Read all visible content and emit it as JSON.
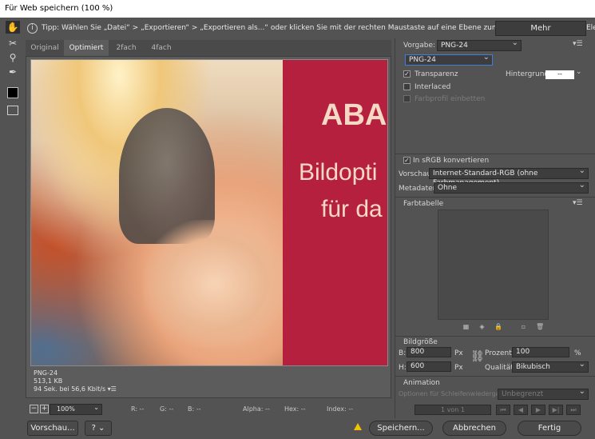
{
  "window": {
    "title": "Für Web speichern (100 %)"
  },
  "hint": {
    "icon": "info-icon",
    "text": "Tipp: Wählen Sie „Datei“ > „Exportieren“ > „Exportieren als...“ oder klicken Sie mit der rechten Maustaste auf eine Ebene zum schnelleren Export von Elementen",
    "more_label": "Mehr"
  },
  "tools": [
    "hand-icon",
    "slice-select-icon",
    "zoom-icon",
    "eyedropper-icon",
    "color-swatch",
    "toggle-slices-icon"
  ],
  "tabs": [
    {
      "label": "Original",
      "active": false
    },
    {
      "label": "Optimiert",
      "active": true
    },
    {
      "label": "2fach",
      "active": false
    },
    {
      "label": "4fach",
      "active": false
    }
  ],
  "preview": {
    "headline": "ABA",
    "line2": "Bildopti",
    "line3": "für da",
    "panel_color": "#b5203f"
  },
  "image_info": {
    "format": "PNG-24",
    "size": "513,1 KB",
    "time": "94 Sek. bei 56,6 Kbit/s"
  },
  "statusbar": {
    "zoom_minus": "−",
    "zoom_plus": "+",
    "zoom": "100%",
    "r": "R: --",
    "g": "G: --",
    "b": "B: --",
    "alpha": "Alpha: --",
    "hex": "Hex: --",
    "index": "Index: --"
  },
  "footer": {
    "preview_label": "Vorschau...",
    "help_icon": "help-icon",
    "save_label": "Speichern...",
    "cancel_label": "Abbrechen",
    "done_label": "Fertig"
  },
  "settings": {
    "preset_label": "Vorgabe:",
    "preset_value": "PNG-24",
    "format_value": "PNG-24",
    "transparency_label": "Transparenz",
    "transparency_checked": true,
    "interlaced_label": "Interlaced",
    "interlaced_checked": false,
    "embed_profile_label": "Farbprofil einbetten",
    "embed_profile_checked": false,
    "background_label": "Hintergrund:",
    "background_value": "--",
    "srgb_label": "In sRGB konvertieren",
    "srgb_checked": true,
    "preview_label": "Vorschau:",
    "preview_value": "Internet-Standard-RGB (ohne Farbmanagement)",
    "metadata_label": "Metadaten:",
    "metadata_value": "Ohne"
  },
  "color_table": {
    "title": "Farbtabelle"
  },
  "image_size": {
    "title": "Bildgröße",
    "w_label": "B:",
    "w_value": "800",
    "h_label": "H:",
    "h_value": "600",
    "unit": "Px",
    "percent_label": "Prozent:",
    "percent_value": "100",
    "percent_unit": "%",
    "quality_label": "Qualität:",
    "quality_value": "Bikubisch"
  },
  "animation": {
    "title": "Animation",
    "loop_label": "Optionen für Schleifenwiedergabe:",
    "loop_value": "Unbegrenzt",
    "frame_counter": "1 von 1"
  }
}
